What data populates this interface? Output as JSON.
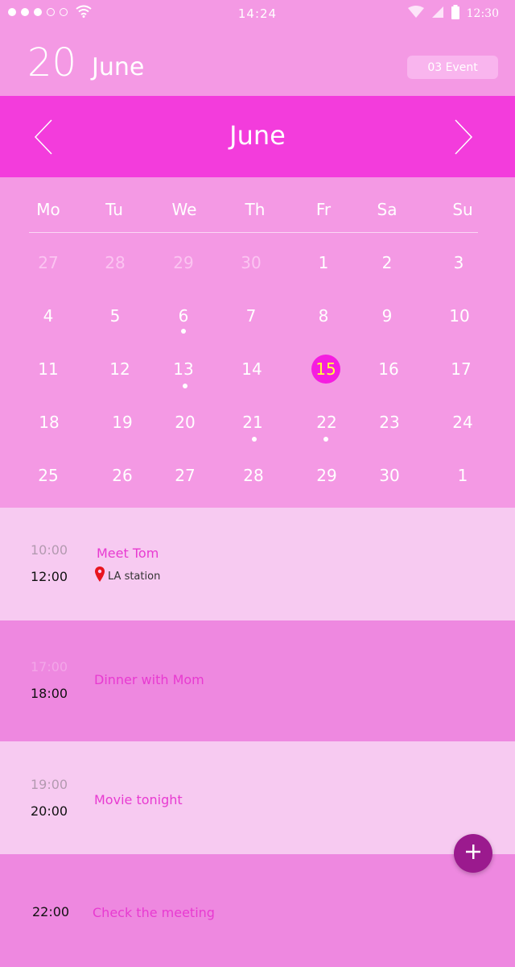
{
  "status_bar": {
    "clock": "14:24",
    "right_time": "12:30"
  },
  "header": {
    "day": "20",
    "month": "June",
    "event_count": "03 Event"
  },
  "calendar": {
    "month_title": "June",
    "weekdays": [
      "Mo",
      "Tu",
      "We",
      "Th",
      "Fr",
      "Sa",
      "Su"
    ],
    "weeks": [
      [
        "27",
        "28",
        "29",
        "30",
        "1",
        "2",
        "3"
      ],
      [
        "4",
        "5",
        "6",
        "7",
        "8",
        "9",
        "10"
      ],
      [
        "11",
        "12",
        "13",
        "14",
        "15",
        "16",
        "17"
      ],
      [
        "18",
        "19",
        "20",
        "21",
        "22",
        "23",
        "24"
      ],
      [
        "25",
        "26",
        "27",
        "28",
        "29",
        "30",
        "1"
      ]
    ],
    "selected_day": "15",
    "days_with_events": [
      "6",
      "13",
      "21",
      "22"
    ]
  },
  "events": [
    {
      "start": "10:00",
      "end": "12:00",
      "title": "Meet Tom",
      "location": "LA station"
    },
    {
      "start": "17:00",
      "end": "18:00",
      "title": "Dinner with Mom"
    },
    {
      "start": "19:00",
      "end": "20:00",
      "title": "Movie tonight"
    },
    {
      "end": "22:00",
      "title": "Check the meeting"
    }
  ],
  "colors": {
    "background": "#f499e4",
    "month_bar": "#f33cdc",
    "today_circle": "#f51de0",
    "today_text": "#ffff3a",
    "event_title": "#e83ad1",
    "fab": "#9b1a8e",
    "location_pin": "#e8141e"
  },
  "icons": {
    "nav_prev": "chevron-left-icon",
    "nav_next": "chevron-right-icon",
    "fab": "plus-icon",
    "location": "map-pin-icon"
  }
}
